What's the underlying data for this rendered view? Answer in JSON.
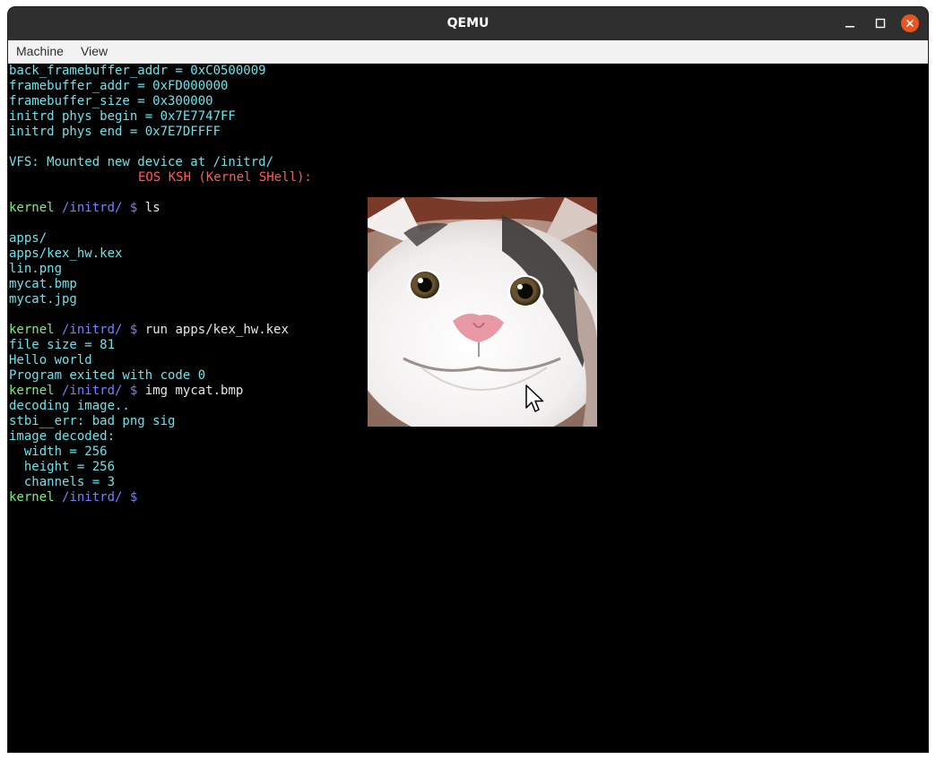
{
  "window": {
    "title": "QEMU",
    "controls": {
      "minimize": "–",
      "maximize": "□",
      "close": "×"
    }
  },
  "menu": [
    "Machine",
    "View"
  ],
  "terminal": {
    "lines": [
      "back_framebuffer_addr = 0xC0500009",
      "framebuffer_addr = 0xFD000000",
      "framebuffer_size = 0x300000",
      "initrd phys begin = 0x7E7747FF",
      "initrd phys end = 0x7E7DFFFF",
      "VFS: Mounted new device at /initrd/",
      "EOS KSH (Kernel SHell):",
      "apps/",
      "apps/kex_hw.kex",
      "lin.png",
      "mycat.bmp",
      "mycat.jpg",
      "file size = 81",
      "Hello world",
      "Program exited with code 0",
      "decoding image..",
      "stbi__err: bad png sig",
      "image decoded:",
      "  width = 256",
      "  height = 256",
      "  channels = 3"
    ],
    "prompt": {
      "user": "kernel",
      "path": "/initrd/",
      "symbol": "$"
    },
    "commands": [
      "ls",
      "run apps/kex_hw.kex",
      "img mycat.bmp",
      ""
    ]
  },
  "colors": {
    "titlebar": "#2f2f2f",
    "close_button": "#e95420",
    "terminal_bg": "#000000",
    "text_cyan": "#6be3ea",
    "prompt_green": "#7af07a",
    "prompt_blue": "#7d7dff",
    "banner_red": "#ff5b5b"
  },
  "icons": {
    "close": "close-icon",
    "maximize": "maximize-icon",
    "minimize": "minimize-icon",
    "cursor": "mouse-pointer-icon"
  }
}
